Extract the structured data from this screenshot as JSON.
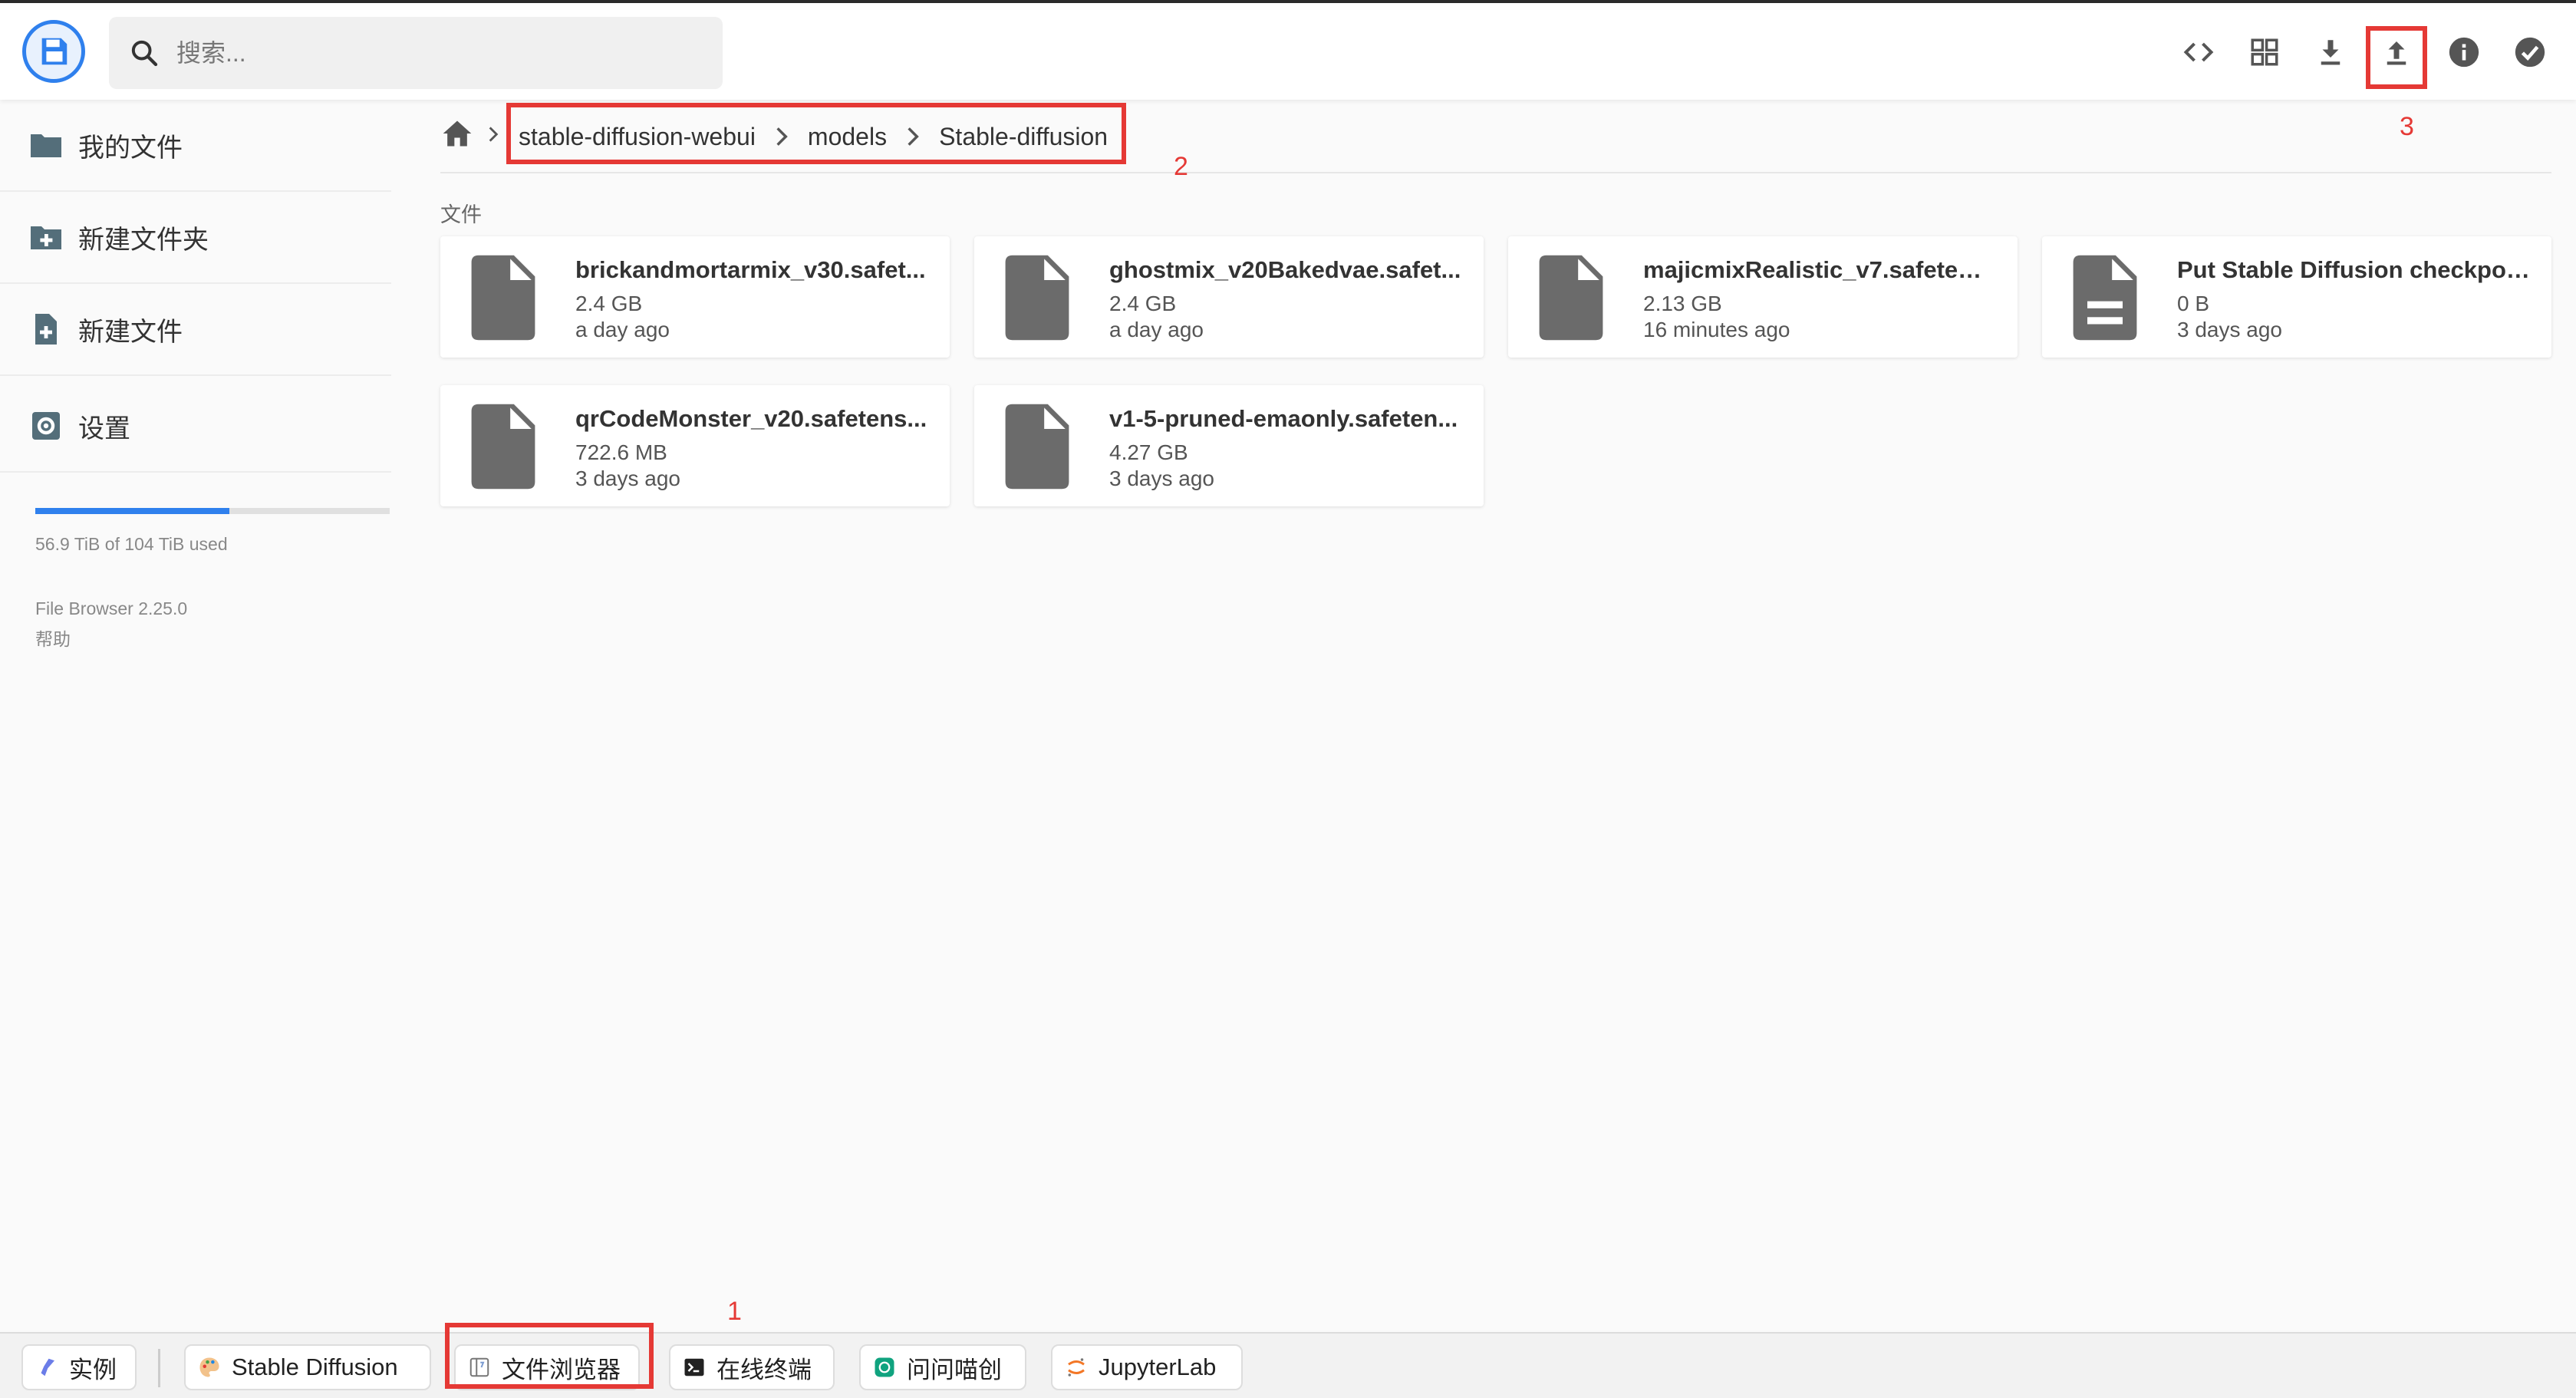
{
  "header": {
    "search_placeholder": "搜索...",
    "actions": [
      "code-view",
      "grid-view",
      "download",
      "upload",
      "info",
      "select"
    ]
  },
  "sidebar": {
    "items": [
      {
        "label": "我的文件",
        "icon": "folder-icon"
      },
      {
        "label": "新建文件夹",
        "icon": "new-folder-icon"
      },
      {
        "label": "新建文件",
        "icon": "new-file-icon"
      },
      {
        "label": "设置",
        "icon": "settings-icon"
      }
    ],
    "quota_text": "56.9 TiB of 104 TiB used",
    "quota_fraction": 0.547,
    "version": "File Browser 2.25.0",
    "help": "帮助"
  },
  "breadcrumb": {
    "items": [
      "stable-diffusion-webui",
      "models",
      "Stable-diffusion"
    ]
  },
  "section_label": "文件",
  "files": [
    {
      "name": "brickandmortarmix_v30.safet...",
      "size": "2.4 GB",
      "modified": "a day ago",
      "icon": "file-icon"
    },
    {
      "name": "ghostmix_v20Bakedvae.safet...",
      "size": "2.4 GB",
      "modified": "a day ago",
      "icon": "file-icon"
    },
    {
      "name": "majicmixRealistic_v7.safetens...",
      "size": "2.13 GB",
      "modified": "16 minutes ago",
      "icon": "file-icon"
    },
    {
      "name": "Put Stable Diffusion checkpoi...",
      "size": "0 B",
      "modified": "3 days ago",
      "icon": "text-file-icon"
    },
    {
      "name": "qrCodeMonster_v20.safetens...",
      "size": "722.6 MB",
      "modified": "3 days ago",
      "icon": "file-icon"
    },
    {
      "name": "v1-5-pruned-emaonly.safeten...",
      "size": "4.27 GB",
      "modified": "3 days ago",
      "icon": "file-icon"
    }
  ],
  "annotations": [
    "1",
    "2",
    "3"
  ],
  "taskbar": {
    "tabs": [
      "实例",
      "Stable Diffusion",
      "文件浏览器",
      "在线终端",
      "问问喵创",
      "JupyterLab"
    ]
  },
  "colors": {
    "accent": "#2f80ed",
    "annotation_red": "#e53935",
    "icon_gray": "#666666"
  }
}
